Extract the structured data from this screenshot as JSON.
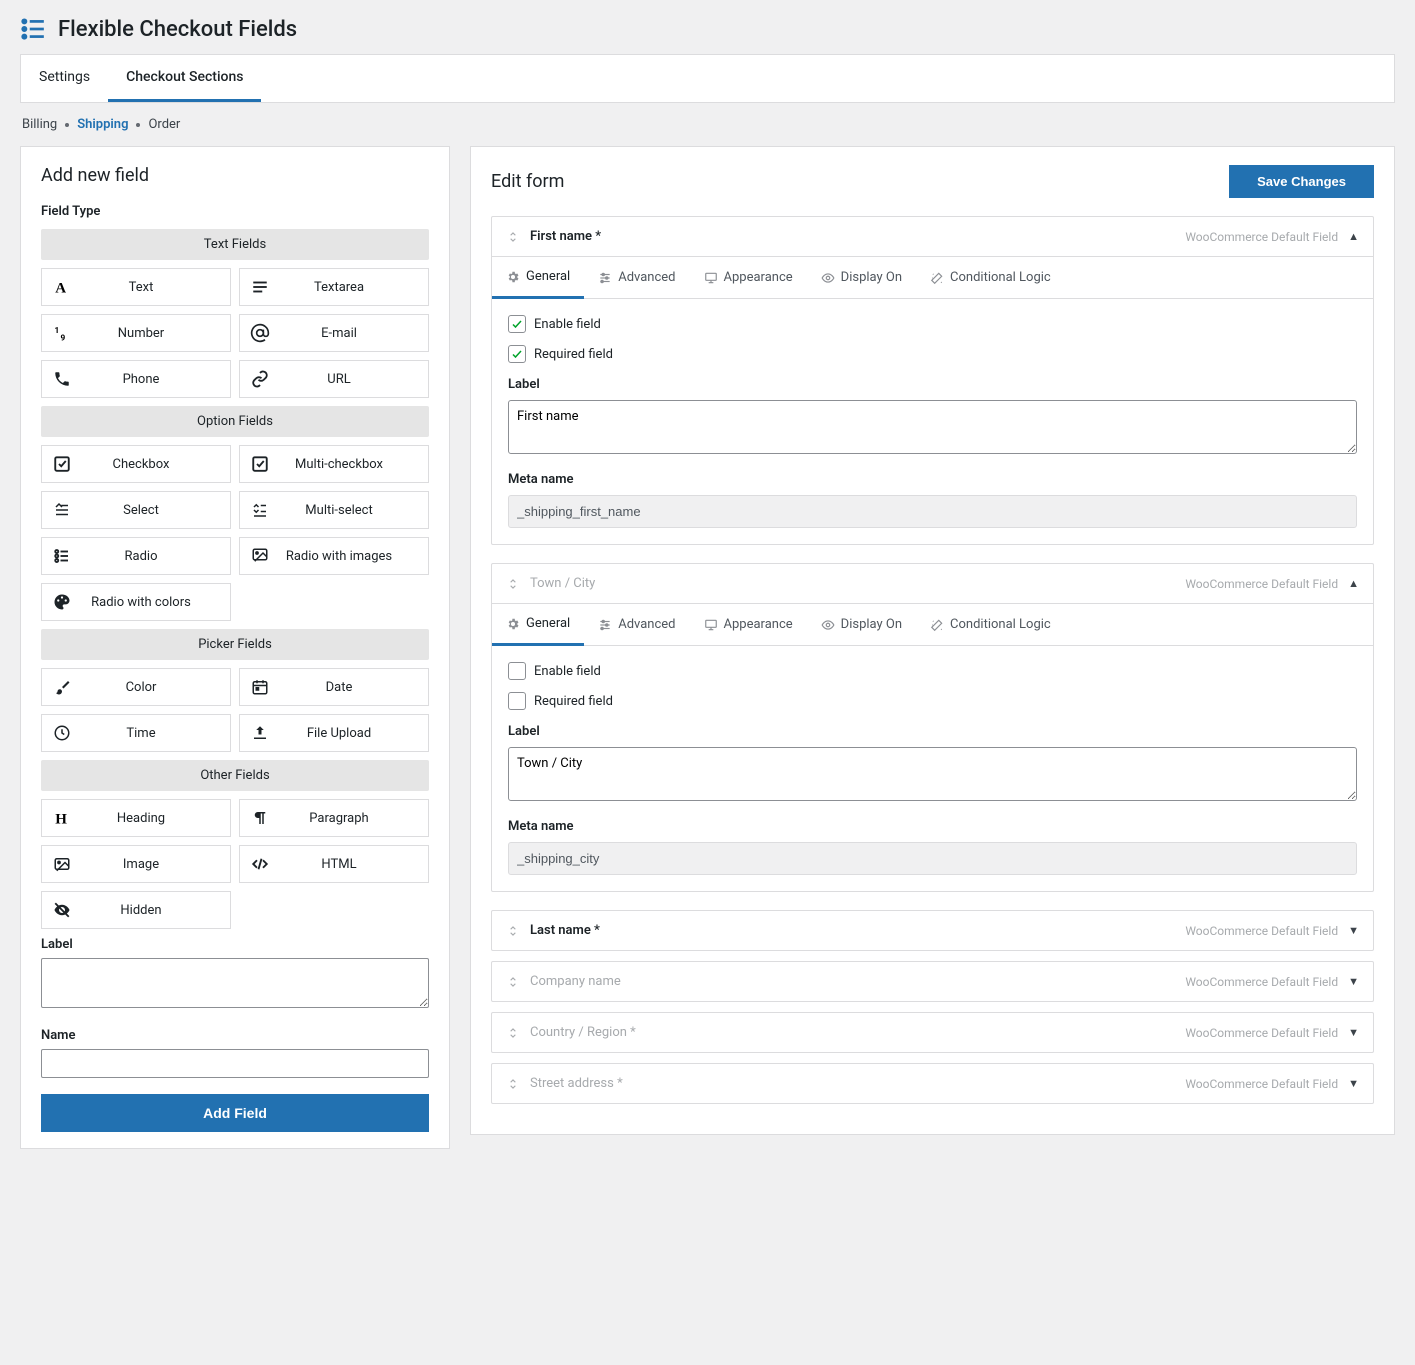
{
  "header": {
    "title": "Flexible Checkout Fields"
  },
  "tabs": [
    "Settings",
    "Checkout Sections"
  ],
  "active_tab": 1,
  "subtabs": [
    "Billing",
    "Shipping",
    "Order"
  ],
  "active_subtab": 1,
  "panel_left": {
    "title": "Add new field",
    "field_type_label": "Field Type",
    "groups": [
      {
        "name": "Text Fields",
        "items": [
          {
            "label": "Text",
            "icon": "font"
          },
          {
            "label": "Textarea",
            "icon": "lines"
          },
          {
            "label": "Number",
            "icon": "number"
          },
          {
            "label": "E-mail",
            "icon": "at"
          },
          {
            "label": "Phone",
            "icon": "phone"
          },
          {
            "label": "URL",
            "icon": "link"
          }
        ]
      },
      {
        "name": "Option Fields",
        "items": [
          {
            "label": "Checkbox",
            "icon": "check"
          },
          {
            "label": "Multi-checkbox",
            "icon": "check"
          },
          {
            "label": "Select",
            "icon": "select"
          },
          {
            "label": "Multi-select",
            "icon": "mselect"
          },
          {
            "label": "Radio",
            "icon": "radio"
          },
          {
            "label": "Radio with images",
            "icon": "img"
          },
          {
            "label": "Radio with colors",
            "icon": "palette"
          }
        ]
      },
      {
        "name": "Picker Fields",
        "items": [
          {
            "label": "Color",
            "icon": "brush"
          },
          {
            "label": "Date",
            "icon": "calendar"
          },
          {
            "label": "Time",
            "icon": "clock"
          },
          {
            "label": "File Upload",
            "icon": "upload"
          }
        ]
      },
      {
        "name": "Other Fields",
        "items": [
          {
            "label": "Heading",
            "icon": "heading"
          },
          {
            "label": "Paragraph",
            "icon": "para"
          },
          {
            "label": "Image",
            "icon": "image"
          },
          {
            "label": "HTML",
            "icon": "code"
          },
          {
            "label": "Hidden",
            "icon": "eyeoff"
          }
        ]
      }
    ],
    "label_label": "Label",
    "name_label": "Name",
    "add_button": "Add Field"
  },
  "panel_right": {
    "title": "Edit form",
    "save_button": "Save Changes",
    "default_badge": "WooCommerce Default Field",
    "field_tabs": [
      "General",
      "Advanced",
      "Appearance",
      "Display On",
      "Conditional Logic"
    ],
    "checkbox_labels": {
      "enable": "Enable field",
      "required": "Required field"
    },
    "form_labels": {
      "label": "Label",
      "meta": "Meta name"
    },
    "fields": [
      {
        "title": "First name *",
        "collapsed": false,
        "muted": false,
        "enable": true,
        "required": true,
        "label_value": "First name",
        "meta_value": "_shipping_first_name"
      },
      {
        "title": "Town / City",
        "collapsed": false,
        "muted": true,
        "enable": false,
        "required": false,
        "label_value": "Town / City",
        "meta_value": "_shipping_city"
      },
      {
        "title": "Last name *",
        "collapsed": true,
        "muted": false
      },
      {
        "title": "Company name",
        "collapsed": true,
        "muted": true
      },
      {
        "title": "Country / Region *",
        "collapsed": true,
        "muted": true
      },
      {
        "title": "Street address *",
        "collapsed": true,
        "muted": true
      }
    ]
  }
}
